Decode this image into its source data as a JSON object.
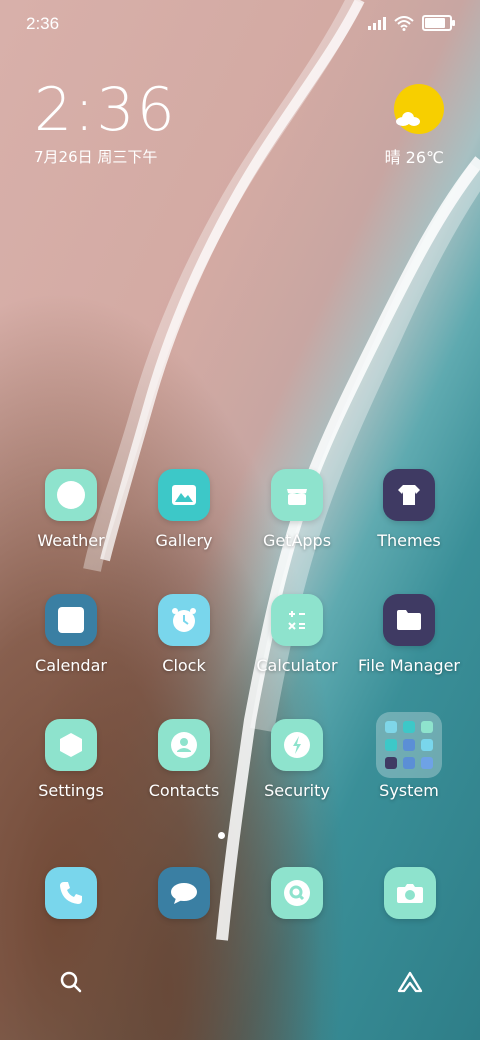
{
  "status_bar": {
    "time": "2:36",
    "signal_icon": "signal-icon",
    "wifi_icon": "wifi-icon",
    "battery_icon": "battery-icon",
    "battery_level": 0.9
  },
  "clock_widget": {
    "time": "2:36",
    "date": "7月26日 周三下午"
  },
  "weather_widget": {
    "icon": "sun-cloud-icon",
    "text": "晴 26℃",
    "sun_color": "#f7cf00"
  },
  "apps": [
    {
      "label": "Weather",
      "icon": "weather-icon"
    },
    {
      "label": "Gallery",
      "icon": "gallery-icon"
    },
    {
      "label": "GetApps",
      "icon": "getapps-icon"
    },
    {
      "label": "Themes",
      "icon": "themes-icon"
    },
    {
      "label": "Calendar",
      "icon": "calendar-icon"
    },
    {
      "label": "Clock",
      "icon": "clock-icon"
    },
    {
      "label": "Calculator",
      "icon": "calculator-icon"
    },
    {
      "label": "File Manager",
      "icon": "file-manager-icon"
    },
    {
      "label": "Settings",
      "icon": "settings-icon"
    },
    {
      "label": "Contacts",
      "icon": "contacts-icon"
    },
    {
      "label": "Security",
      "icon": "security-icon"
    },
    {
      "label": "System",
      "icon": "folder-icon"
    }
  ],
  "dock": [
    {
      "icon": "phone-icon"
    },
    {
      "icon": "messages-icon"
    },
    {
      "icon": "browser-icon"
    },
    {
      "icon": "camera-icon"
    }
  ],
  "bottom_bar": {
    "search_icon": "search-icon",
    "assistant_icon": "app-vault-icon"
  },
  "colors": {
    "mint": "#8ee3cd",
    "teal": "#3dc8c8",
    "ocean": "#3a7fa3",
    "sky": "#79d6ec",
    "plum": "#3f3a63"
  }
}
